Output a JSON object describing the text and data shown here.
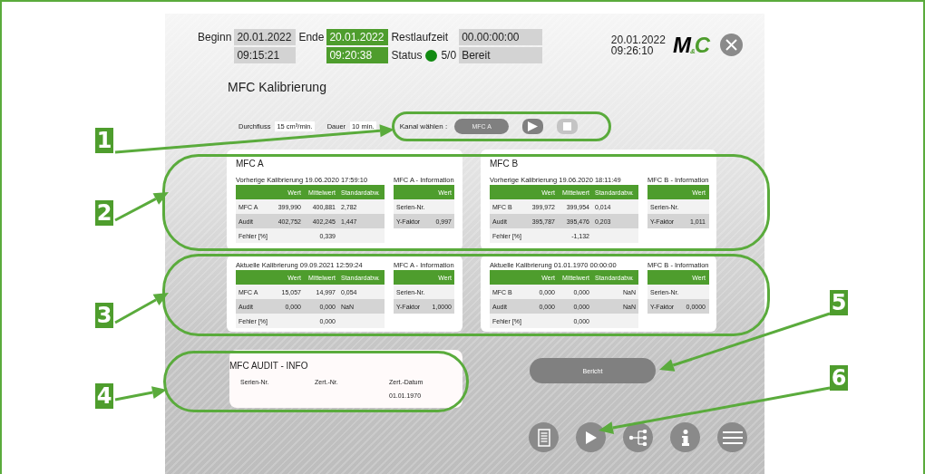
{
  "header": {
    "begin": {
      "label": "Beginn",
      "values": [
        {
          "text": "20.01.2022",
          "active": false
        },
        {
          "text": "09:15:21",
          "active": false
        }
      ]
    },
    "end": {
      "label": "Ende",
      "values": [
        {
          "text": "20.01.2022",
          "active": true
        },
        {
          "text": "09:20:38",
          "active": true
        }
      ]
    },
    "remaining": {
      "label": "Restlaufzeit",
      "value": "00.00:00:00"
    },
    "status": {
      "label": "Status",
      "ok": true,
      "code": "5/0",
      "value": "Bereit"
    },
    "datetime": [
      "20.01.2022",
      "09:26:10"
    ],
    "logo": {
      "first": "M",
      "small": "&",
      "last": "C"
    }
  },
  "title": "MFC Kalibrierung",
  "params": [
    {
      "label": "Durchfluss",
      "value": "15 cm³/min."
    },
    {
      "label": "Dauer",
      "value": "10 min."
    }
  ],
  "channel": {
    "label": "Kanal wählen :",
    "value": "MFC A",
    "stop_disabled": true
  },
  "calibrations": [
    {
      "title": "MFC A",
      "heading": "Vorherige Kalibrierung 19.06.2020 17:59:10",
      "columns": [
        "Wert",
        "Mittelwert",
        "Standardabw."
      ],
      "rows": [
        {
          "label": "MFC A",
          "wert": "399,990",
          "mittelwert": "400,881",
          "std": "2,782"
        },
        {
          "label": "Audit",
          "wert": "402,752",
          "mittelwert": "402,245",
          "std": "1,447"
        },
        {
          "label": "Fehler [%]",
          "mittelwert": "0,339"
        }
      ],
      "info": {
        "title": "MFC A - Information",
        "column": "Wert",
        "rows": [
          {
            "label": "Serien-Nr."
          },
          {
            "label": "Y-Faktor",
            "value": "0,997"
          }
        ]
      }
    },
    {
      "title": "MFC B",
      "heading": "Vorherige Kalibrierung 19.06.2020 18:11:49",
      "columns": [
        "Wert",
        "Mittelwert",
        "Standardabw."
      ],
      "rows": [
        {
          "label": "MFC B",
          "wert": "399,972",
          "mittelwert": "399,954",
          "std": "0,014"
        },
        {
          "label": "Audit",
          "wert": "395,787",
          "mittelwert": "395,476",
          "std": "0,203"
        },
        {
          "label": "Fehler [%]",
          "mittelwert": "-1,132"
        }
      ],
      "info": {
        "title": "MFC B - Information",
        "column": "Wert",
        "rows": [
          {
            "label": "Serien-Nr."
          },
          {
            "label": "Y-Faktor",
            "value": "1,011"
          }
        ]
      }
    },
    {
      "heading": "Aktuelle Kalibrierung 09.09.2021 12:59:24",
      "columns": [
        "Wert",
        "Mittelwert",
        "Standardabw."
      ],
      "rows": [
        {
          "label": "MFC A",
          "wert": "15,057",
          "mittelwert": "14,997",
          "std": "0,054"
        },
        {
          "label": "Audit",
          "wert": "0,000",
          "mittelwert": "0,000",
          "std": "NaN"
        },
        {
          "label": "Fehler [%]",
          "mittelwert": "0,000"
        }
      ],
      "info": {
        "title": "MFC A - Information",
        "column": "Wert",
        "rows": [
          {
            "label": "Serien-Nr."
          },
          {
            "label": "Y-Faktor",
            "value": "1,0000"
          }
        ]
      }
    },
    {
      "heading": "Aktuelle Kalibrierung 01.01.1970 00:00:00",
      "columns": [
        "Wert",
        "Mittelwert",
        "Standardabw."
      ],
      "rows": [
        {
          "label": "MFC B",
          "wert": "0,000",
          "mittelwert": "0,000",
          "std": "NaN"
        },
        {
          "label": "Audit",
          "wert": "0,000",
          "mittelwert": "0,000",
          "std": "NaN"
        },
        {
          "label": "Fehler [%]",
          "mittelwert": "0,000"
        }
      ],
      "info": {
        "title": "MFC B - Information",
        "column": "Wert",
        "rows": [
          {
            "label": "Serien-Nr."
          },
          {
            "label": "Y-Faktor",
            "value": "0,0000"
          }
        ]
      }
    }
  ],
  "audit": {
    "title": "MFC AUDIT - INFO",
    "columns": [
      {
        "label": "Serien-Nr."
      },
      {
        "label": "Zert.-Nr."
      },
      {
        "label": "Zert.-Datum",
        "value": "01.01.1970"
      }
    ]
  },
  "report_button": "Bericht",
  "annotations": [
    "1",
    "2",
    "3",
    "4",
    "5",
    "6"
  ]
}
